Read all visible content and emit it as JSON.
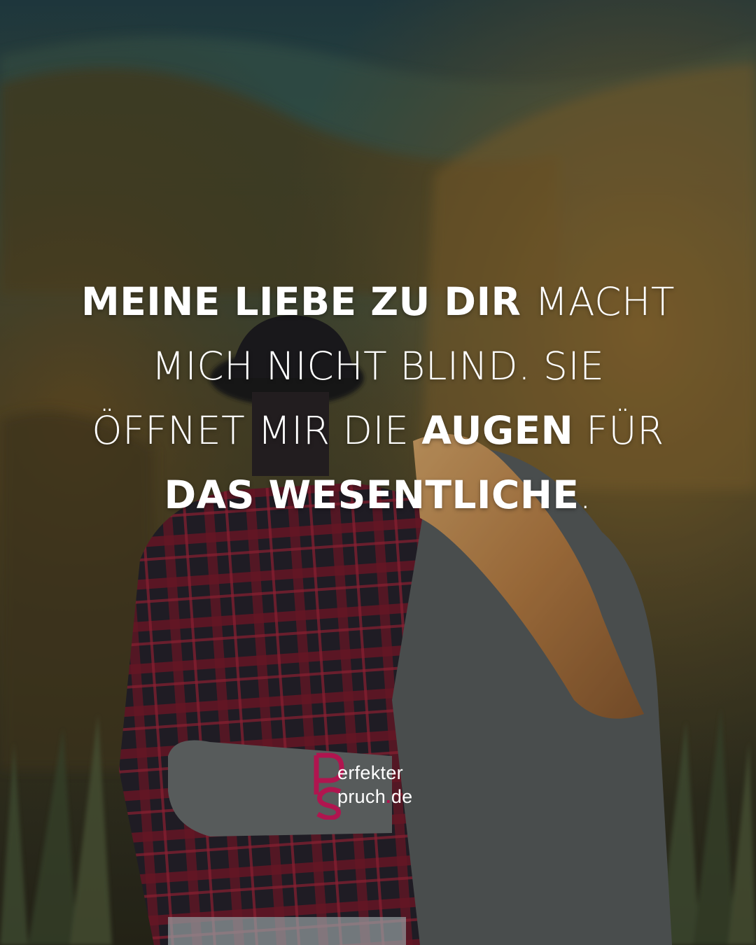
{
  "quote": {
    "line1": [
      {
        "text": "MEINE LIEBE ZU DIR ",
        "bold": true
      },
      {
        "text": "MACHT",
        "bold": false
      }
    ],
    "line2": [
      {
        "text": "MICH NICHT BLIND. SIE",
        "bold": false
      }
    ],
    "line3": [
      {
        "text": "ÖFFNET MIR DIE ",
        "bold": false
      },
      {
        "text": "AUGEN",
        "bold": true
      },
      {
        "text": " FÜR",
        "bold": false
      }
    ],
    "line4": [
      {
        "text": "DAS WESENTLICHE",
        "bold": true
      },
      {
        "text": ".",
        "bold": false
      }
    ]
  },
  "logo": {
    "word1": "erfekter",
    "word2": "pruch",
    "dot": ".",
    "tld": "de",
    "brand_color": "#b0154f"
  },
  "colors": {
    "sky_teal": "#2e4a4d",
    "foliage": "#7a5a28",
    "shirt_red": "#7a1a2c",
    "hair": "#c9945a",
    "jacket_grey": "#5a5e5e"
  }
}
